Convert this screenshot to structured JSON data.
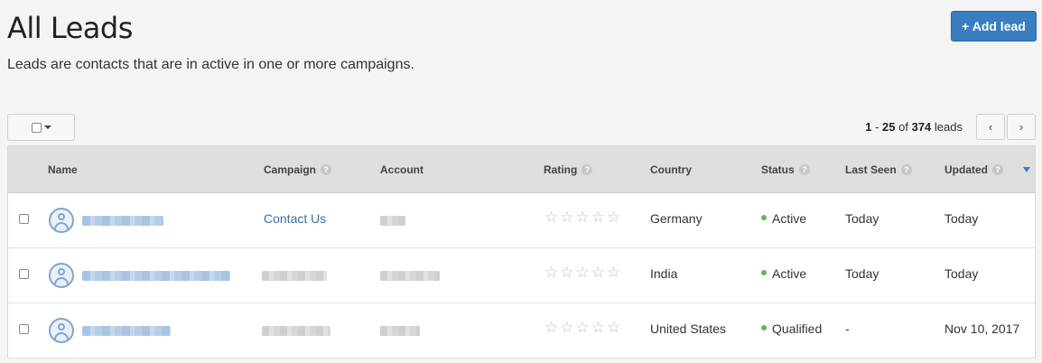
{
  "header": {
    "title": "All Leads",
    "subtitle": "Leads are contacts that are in active in one or more campaigns.",
    "add_button": "+ Add lead"
  },
  "pagination": {
    "range_start": "1",
    "range_sep": " - ",
    "range_end": "25",
    "of": " of ",
    "total": "374",
    "unit": " leads",
    "prev_icon": "‹",
    "next_icon": "›"
  },
  "columns": {
    "name": "Name",
    "campaign": "Campaign",
    "account": "Account",
    "rating": "Rating",
    "country": "Country",
    "status": "Status",
    "last_seen": "Last Seen",
    "updated": "Updated"
  },
  "help_glyph": "?",
  "icons": {
    "avatar": "user-avatar-icon",
    "sort": "sort-desc-icon",
    "help": "question-circle-icon",
    "star": "star-outline-icon"
  },
  "colors": {
    "accent": "#3a7ec1",
    "status_dot": "#5cb85c"
  },
  "rows": [
    {
      "campaign": "Contact Us",
      "rating": "☆☆☆☆☆",
      "country": "Germany",
      "status": "Active",
      "last_seen": "Today",
      "updated": "Today"
    },
    {
      "campaign": "",
      "rating": "☆☆☆☆☆",
      "country": "India",
      "status": "Active",
      "last_seen": "Today",
      "updated": "Today"
    },
    {
      "campaign": "",
      "rating": "☆☆☆☆☆",
      "country": "United States",
      "status": "Qualified",
      "last_seen": "-",
      "updated": "Nov 10, 2017"
    }
  ]
}
